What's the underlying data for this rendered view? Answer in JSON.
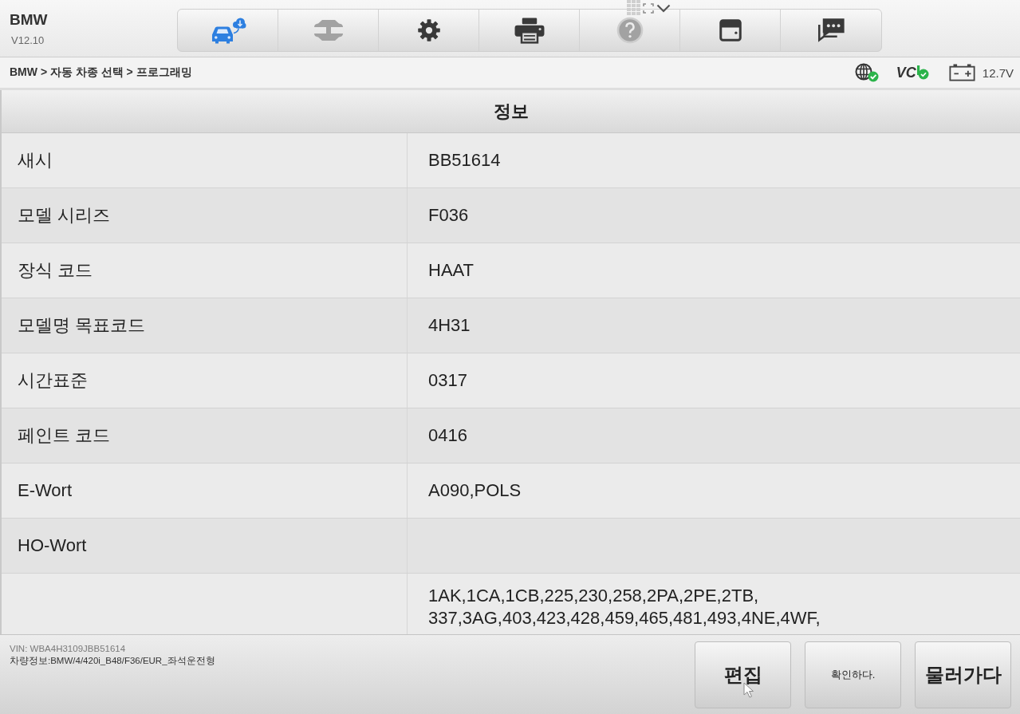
{
  "app": {
    "title": "BMW",
    "version": "V12.10"
  },
  "toolbar": [
    {
      "kind": "vehicle-cloud",
      "disabled": false
    },
    {
      "kind": "lift",
      "disabled": true
    },
    {
      "kind": "settings",
      "disabled": false
    },
    {
      "kind": "print",
      "disabled": false
    },
    {
      "kind": "help",
      "disabled": true
    },
    {
      "kind": "save",
      "disabled": false
    },
    {
      "kind": "messages",
      "disabled": false
    }
  ],
  "breadcrumb": "BMW > 자동 차종 선택 > 프로그래밍",
  "status": {
    "vci_label": "VC",
    "battery_voltage": "12.7V"
  },
  "table": {
    "title": "정보",
    "rows": [
      {
        "label": "새시",
        "value": "BB51614"
      },
      {
        "label": "모델 시리즈",
        "value": "F036"
      },
      {
        "label": "장식 코드",
        "value": "HAAT"
      },
      {
        "label": "모델명 목표코드",
        "value": "4H31"
      },
      {
        "label": "시간표준",
        "value": "0317"
      },
      {
        "label": "페인트 코드",
        "value": "0416"
      },
      {
        "label": "E-Wort",
        "value": "A090,POLS"
      },
      {
        "label": "HO-Wort"
      },
      {
        "value_lines": [
          "1AK,1CA,1CB,225,230,258,2PA,2PE,2TB,",
          "337,3AG,403,423,428,459,465,481,493,4NE,4WF,"
        ]
      }
    ]
  },
  "footer": {
    "vin": "VIN: WBA4H3109JBB51614",
    "vehicle_info": "차량정보:BMW/4/420i_B48/F36/EUR_좌석운전형",
    "buttons": [
      {
        "label": "편집",
        "kind": "large",
        "hovered": true
      },
      {
        "label": "확인하다.",
        "kind": "small",
        "hovered": false
      },
      {
        "label": "물러가다",
        "kind": "large",
        "hovered": false
      }
    ]
  }
}
